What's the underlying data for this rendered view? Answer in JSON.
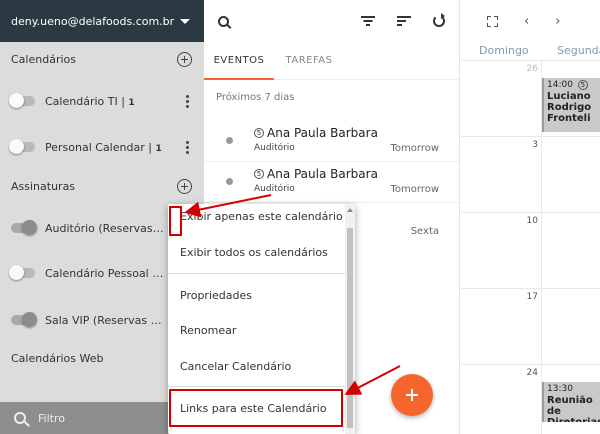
{
  "sidebar": {
    "account": "deny.ueno@delafoods.com.br",
    "sections": {
      "calendars": "Calendários",
      "subscriptions": "Assinaturas",
      "web_calendars": "Calendários Web"
    },
    "calendars": [
      {
        "name": "Calendário TI",
        "count": "1",
        "enabled": false
      },
      {
        "name": "Personal Calendar",
        "count": "1",
        "enabled": false
      }
    ],
    "subscriptions": [
      {
        "name": "Auditório (Reservas Delafoods)",
        "enabled": true
      },
      {
        "name": "Calendário Pessoal ( <p...",
        "enabled": false
      },
      {
        "name": "Sala VIP (Reservas Delafoods)",
        "enabled": true
      }
    ],
    "filter_placeholder": "Filtro"
  },
  "middle": {
    "tabs": [
      "EVENTOS",
      "TAREFAS"
    ],
    "active_tab": "EVENTOS",
    "range": "Próximos 7 dias",
    "events": [
      {
        "badge": "5",
        "title": "Ana Paula Barbara",
        "location": "Auditório",
        "when": "Tomorrow"
      },
      {
        "badge": "5",
        "title": "Ana Paula Barbara",
        "location": "Auditório",
        "when": "Tomorrow"
      }
    ],
    "third_when": "Sexta"
  },
  "calendar": {
    "day_headers": [
      "Domingo",
      "Segunda"
    ],
    "weeks": [
      "26",
      "3",
      "10",
      "17",
      "24"
    ],
    "events": [
      {
        "time": "14:00",
        "badge": "5",
        "title": "Luciano Rodrigo Fronteli"
      },
      {
        "time": "13:30",
        "title": "Reunião de Diretorias"
      }
    ]
  },
  "context_menu": {
    "items": [
      "Exibir apenas este calendário",
      "Exibir todos os calendários",
      "Propriedades",
      "Renomear",
      "Cancelar Calendário",
      "Links para este Calendário"
    ]
  },
  "colors": {
    "accent": "#f5662e",
    "header_dark": "#2b3a42",
    "annotation": "#d40000"
  }
}
